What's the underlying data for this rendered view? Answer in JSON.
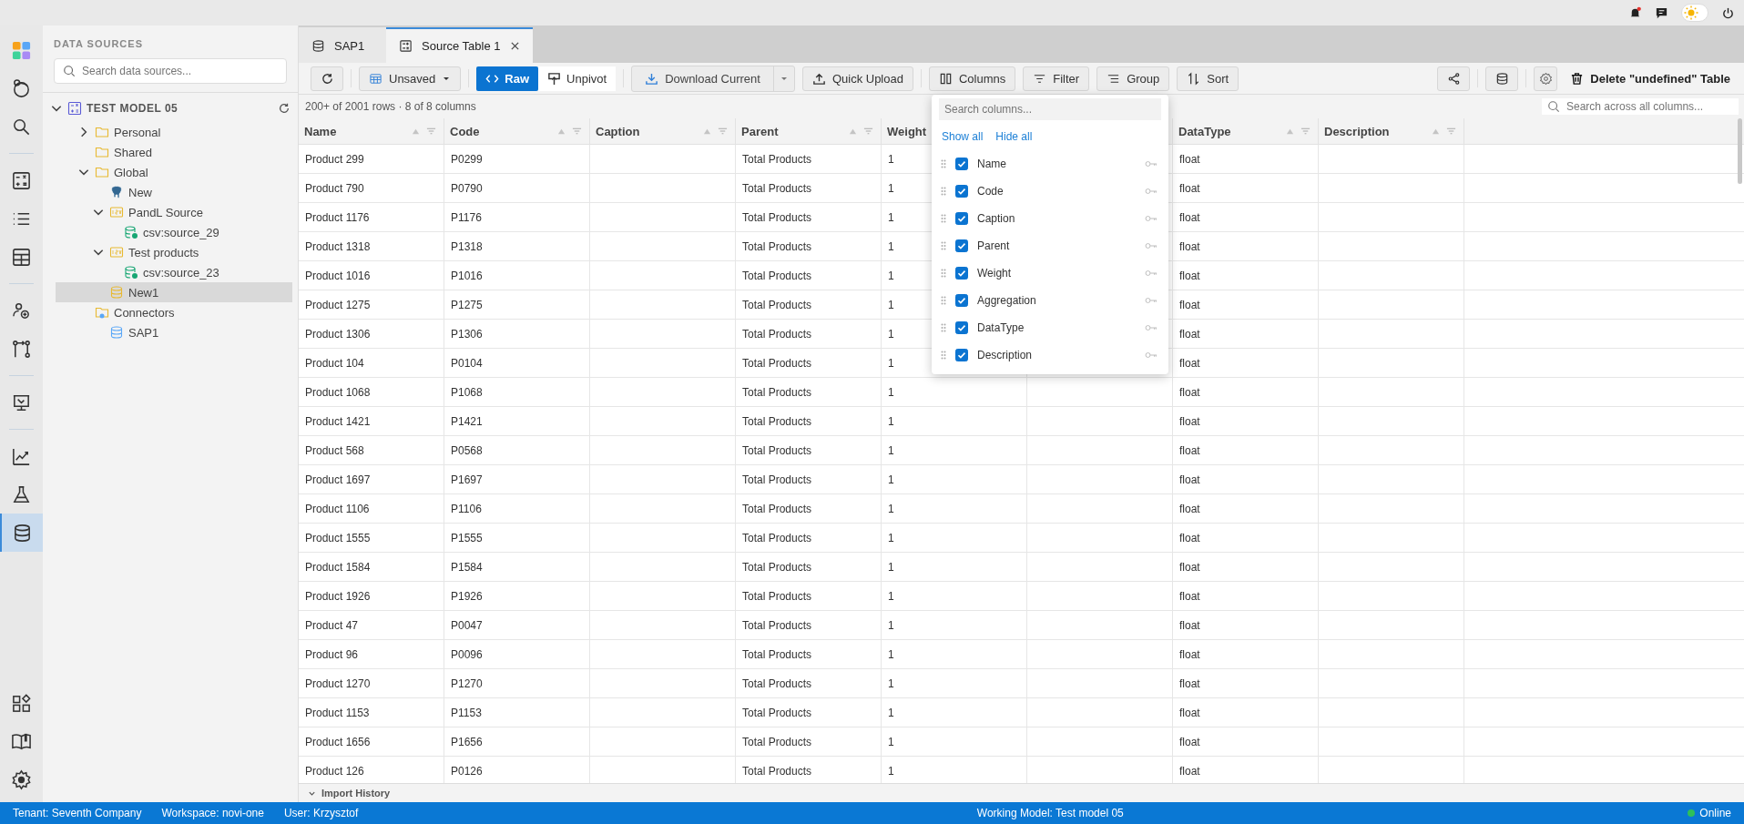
{
  "top_bar": {
    "dark_mode": false
  },
  "rail": {
    "groups": [
      {
        "items": [
          {
            "kind": "apps",
            "selected": false
          },
          {
            "kind": "avatar",
            "selected": false
          },
          {
            "kind": "search",
            "selected": false
          }
        ]
      },
      {
        "items": [
          {
            "kind": "calculator",
            "selected": false
          },
          {
            "kind": "list",
            "selected": false
          },
          {
            "kind": "table",
            "selected": false
          }
        ]
      },
      {
        "items": [
          {
            "kind": "users",
            "selected": false
          },
          {
            "kind": "flow",
            "selected": false
          }
        ]
      },
      {
        "items": [
          {
            "kind": "presentation",
            "selected": false
          }
        ]
      },
      {
        "items": [
          {
            "kind": "chart",
            "selected": false
          },
          {
            "kind": "flask",
            "selected": false
          },
          {
            "kind": "database",
            "selected": true
          }
        ]
      }
    ],
    "bottom": [
      {
        "kind": "widgets",
        "selected": false
      },
      {
        "kind": "book",
        "selected": false
      },
      {
        "kind": "settings",
        "selected": false
      }
    ]
  },
  "sidebar": {
    "title": "DATA SOURCES",
    "search": {
      "placeholder": "Search data sources..."
    },
    "tree": [
      {
        "label": "TEST MODEL 05",
        "kind": "model",
        "expanded": true,
        "selected": false,
        "children": [
          {
            "label": "Personal",
            "kind": "folder",
            "expanded": false,
            "selected": false
          },
          {
            "label": "Shared",
            "kind": "folder",
            "selected": false
          },
          {
            "label": "Global",
            "kind": "folder",
            "expanded": true,
            "selected": false,
            "children": [
              {
                "label": "New",
                "kind": "postgres",
                "selected": false
              },
              {
                "label": "PandL Source",
                "kind": "csv",
                "expanded": true,
                "selected": false,
                "children": [
                  {
                    "label": "csv:source_29",
                    "kind": "source",
                    "selected": false
                  }
                ]
              },
              {
                "label": "Test products",
                "kind": "csv",
                "expanded": true,
                "selected": false,
                "children": [
                  {
                    "label": "csv:source_23",
                    "kind": "source",
                    "selected": false
                  }
                ]
              },
              {
                "label": "New1",
                "kind": "dataset",
                "selected": true
              }
            ]
          },
          {
            "label": "Connectors",
            "kind": "connectors",
            "selected": false,
            "children": [
              {
                "label": "SAP1",
                "kind": "connector",
                "selected": false
              }
            ]
          }
        ]
      }
    ]
  },
  "tabs": [
    {
      "label": "SAP1",
      "kind": "database",
      "selected": false,
      "closable": false
    },
    {
      "label": "Source Table 1",
      "kind": "table",
      "selected": true,
      "closable": true
    }
  ],
  "toolbar": {
    "view": "Unsaved",
    "modes": [
      {
        "label": "Raw",
        "kind": "code",
        "selected": true
      },
      {
        "label": "Unpivot",
        "kind": "unpivot",
        "selected": false
      }
    ],
    "download": "Download Current",
    "upload": "Quick Upload",
    "tools": [
      {
        "label": "Columns",
        "kind": "columns"
      },
      {
        "label": "Filter",
        "kind": "filter"
      },
      {
        "label": "Group",
        "kind": "group"
      },
      {
        "label": "Sort",
        "kind": "sort"
      }
    ],
    "delete": "Delete \"undefined\" Table"
  },
  "summary": "200+ of 2001 rows · 8 of 8 columns",
  "table_search": {
    "placeholder": "Search across all columns..."
  },
  "table": {
    "columns": [
      {
        "label": "Name"
      },
      {
        "label": "Code"
      },
      {
        "label": "Caption"
      },
      {
        "label": "Parent"
      },
      {
        "label": "Weight"
      },
      {},
      {
        "label": "DataType"
      },
      {
        "label": "Description"
      }
    ],
    "rows": [
      {
        "name": "Product 299",
        "code": "P0299",
        "parent": "Total Products",
        "weight": "1",
        "datatype": "float"
      },
      {
        "name": "Product 790",
        "code": "P0790",
        "parent": "Total Products",
        "weight": "1",
        "datatype": "float"
      },
      {
        "name": "Product 1176",
        "code": "P1176",
        "parent": "Total Products",
        "weight": "1",
        "datatype": "float"
      },
      {
        "name": "Product 1318",
        "code": "P1318",
        "parent": "Total Products",
        "weight": "1",
        "datatype": "float"
      },
      {
        "name": "Product 1016",
        "code": "P1016",
        "parent": "Total Products",
        "weight": "1",
        "datatype": "float"
      },
      {
        "name": "Product 1275",
        "code": "P1275",
        "parent": "Total Products",
        "weight": "1",
        "datatype": "float"
      },
      {
        "name": "Product 1306",
        "code": "P1306",
        "parent": "Total Products",
        "weight": "1",
        "datatype": "float"
      },
      {
        "name": "Product 104",
        "code": "P0104",
        "parent": "Total Products",
        "weight": "1",
        "datatype": "float"
      },
      {
        "name": "Product 1068",
        "code": "P1068",
        "parent": "Total Products",
        "weight": "1",
        "datatype": "float"
      },
      {
        "name": "Product 1421",
        "code": "P1421",
        "parent": "Total Products",
        "weight": "1",
        "datatype": "float"
      },
      {
        "name": "Product 568",
        "code": "P0568",
        "parent": "Total Products",
        "weight": "1",
        "datatype": "float"
      },
      {
        "name": "Product 1697",
        "code": "P1697",
        "parent": "Total Products",
        "weight": "1",
        "datatype": "float"
      },
      {
        "name": "Product 1106",
        "code": "P1106",
        "parent": "Total Products",
        "weight": "1",
        "datatype": "float"
      },
      {
        "name": "Product 1555",
        "code": "P1555",
        "parent": "Total Products",
        "weight": "1",
        "datatype": "float"
      },
      {
        "name": "Product 1584",
        "code": "P1584",
        "parent": "Total Products",
        "weight": "1",
        "datatype": "float"
      },
      {
        "name": "Product 1926",
        "code": "P1926",
        "parent": "Total Products",
        "weight": "1",
        "datatype": "float"
      },
      {
        "name": "Product 47",
        "code": "P0047",
        "parent": "Total Products",
        "weight": "1",
        "datatype": "float"
      },
      {
        "name": "Product 96",
        "code": "P0096",
        "parent": "Total Products",
        "weight": "1",
        "datatype": "float"
      },
      {
        "name": "Product 1270",
        "code": "P1270",
        "parent": "Total Products",
        "weight": "1",
        "datatype": "float"
      },
      {
        "name": "Product 1153",
        "code": "P1153",
        "parent": "Total Products",
        "weight": "1",
        "datatype": "float"
      },
      {
        "name": "Product 1656",
        "code": "P1656",
        "parent": "Total Products",
        "weight": "1",
        "datatype": "float"
      },
      {
        "name": "Product 126",
        "code": "P0126",
        "parent": "Total Products",
        "weight": "1",
        "datatype": "float"
      }
    ]
  },
  "column_picker": {
    "search_placeholder": "Search columns...",
    "show_all": "Show all",
    "hide_all": "Hide all",
    "items": [
      {
        "label": "Name",
        "checked": true
      },
      {
        "label": "Code",
        "checked": true
      },
      {
        "label": "Caption",
        "checked": true
      },
      {
        "label": "Parent",
        "checked": true
      },
      {
        "label": "Weight",
        "checked": true
      },
      {
        "label": "Aggregation",
        "checked": true
      },
      {
        "label": "DataType",
        "checked": true
      },
      {
        "label": "Description",
        "checked": true
      }
    ]
  },
  "import_history": {
    "label": "Import History",
    "expanded": false
  },
  "status_bar": {
    "left": [
      "Tenant: Seventh Company",
      "Workspace: novi-one",
      "User: Krzysztof"
    ],
    "center": "Working Model: Test model 05",
    "status": "Online",
    "online": true
  }
}
